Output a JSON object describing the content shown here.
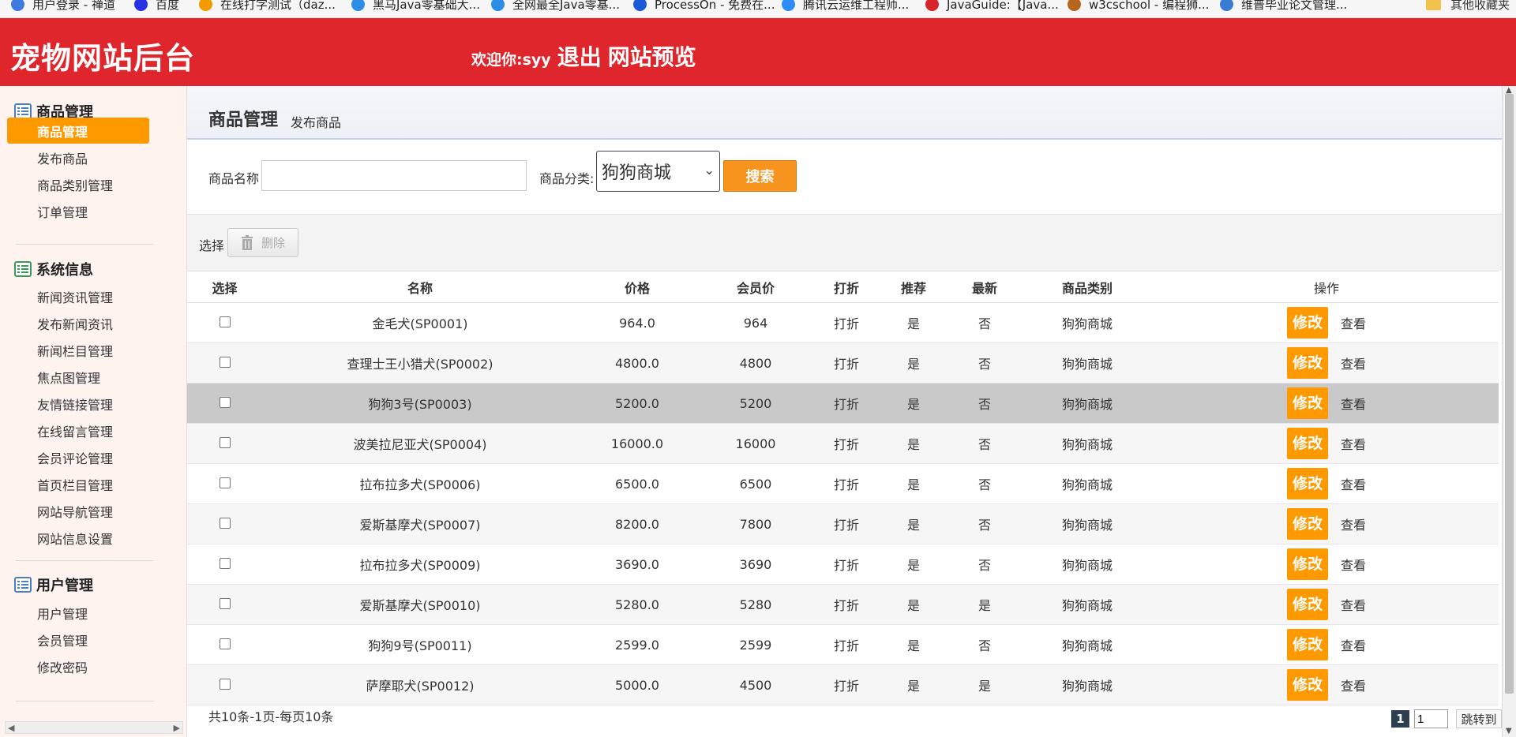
{
  "bookmarks": [
    {
      "label": "用户登录 - 禅道",
      "color": "#3d7be0"
    },
    {
      "label": "百度",
      "color": "#2932e1"
    },
    {
      "label": "在线打字测试（daz...",
      "color": "#f29b00"
    },
    {
      "label": "黑马Java零基础大...",
      "color": "#2b8de6"
    },
    {
      "label": "全网最全Java零基...",
      "color": "#2b8de6"
    },
    {
      "label": "ProcessOn - 免费在...",
      "color": "#1a5ad8"
    },
    {
      "label": "腾讯云运维工程师...",
      "color": "#2f8bf5"
    },
    {
      "label": "JavaGuide:【Java...",
      "color": "#d8252b"
    },
    {
      "label": "w3cschool - 编程狮...",
      "color": "#b5651d"
    },
    {
      "label": "维普毕业论文管理...",
      "color": "#3a7bd5"
    }
  ],
  "bookmarks_folder": "其他收藏夹",
  "header": {
    "title": "宠物网站后台",
    "welcome": "欢迎你:syy",
    "logout": "退出",
    "preview": "网站预览"
  },
  "sidebar": {
    "groups": [
      {
        "title": "商品管理",
        "items": [
          "商品管理",
          "发布商品",
          "商品类别管理",
          "订单管理"
        ],
        "active": 0
      },
      {
        "title": "系统信息",
        "items": [
          "新闻资讯管理",
          "发布新闻资讯",
          "新闻栏目管理",
          "焦点图管理",
          "友情链接管理",
          "在线留言管理",
          "会员评论管理",
          "首页栏目管理",
          "网站导航管理",
          "网站信息设置"
        ]
      },
      {
        "title": "用户管理",
        "items": [
          "用户管理",
          "会员管理",
          "修改密码"
        ]
      }
    ]
  },
  "main": {
    "title": "商品管理",
    "subtitle": "发布商品",
    "search": {
      "name_label": "商品名称",
      "name_value": "",
      "category_label": "商品分类:",
      "category_value": "狗狗商城",
      "button": "搜索"
    },
    "toolbar": {
      "select_label": "选择",
      "delete_label": "删除"
    },
    "table": {
      "headers": [
        "选择",
        "名称",
        "价格",
        "会员价",
        "打折",
        "推荐",
        "最新",
        "商品类别",
        "操作"
      ],
      "edit_label": "修改",
      "view_label": "查看",
      "rows": [
        {
          "name": "金毛犬(SP0001)",
          "price": "964.0",
          "member_price": "964",
          "discount": "打折",
          "recommend": "是",
          "latest": "否",
          "category": "狗狗商城"
        },
        {
          "name": "查理士王小猎犬(SP0002)",
          "price": "4800.0",
          "member_price": "4800",
          "discount": "打折",
          "recommend": "是",
          "latest": "否",
          "category": "狗狗商城"
        },
        {
          "name": "狗狗3号(SP0003)",
          "price": "5200.0",
          "member_price": "5200",
          "discount": "打折",
          "recommend": "是",
          "latest": "否",
          "category": "狗狗商城"
        },
        {
          "name": "波美拉尼亚犬(SP0004)",
          "price": "16000.0",
          "member_price": "16000",
          "discount": "打折",
          "recommend": "是",
          "latest": "否",
          "category": "狗狗商城"
        },
        {
          "name": "拉布拉多犬(SP0006)",
          "price": "6500.0",
          "member_price": "6500",
          "discount": "打折",
          "recommend": "是",
          "latest": "否",
          "category": "狗狗商城"
        },
        {
          "name": "爱斯基摩犬(SP0007)",
          "price": "8200.0",
          "member_price": "7800",
          "discount": "打折",
          "recommend": "是",
          "latest": "否",
          "category": "狗狗商城"
        },
        {
          "name": "拉布拉多犬(SP0009)",
          "price": "3690.0",
          "member_price": "3690",
          "discount": "打折",
          "recommend": "是",
          "latest": "否",
          "category": "狗狗商城"
        },
        {
          "name": "爱斯基摩犬(SP0010)",
          "price": "5280.0",
          "member_price": "5280",
          "discount": "打折",
          "recommend": "是",
          "latest": "是",
          "category": "狗狗商城"
        },
        {
          "name": "狗狗9号(SP0011)",
          "price": "2599.0",
          "member_price": "2599",
          "discount": "打折",
          "recommend": "是",
          "latest": "否",
          "category": "狗狗商城"
        },
        {
          "name": "萨摩耶犬(SP0012)",
          "price": "5000.0",
          "member_price": "4500",
          "discount": "打折",
          "recommend": "是",
          "latest": "是",
          "category": "狗狗商城"
        }
      ]
    },
    "footer": {
      "summary": "共10条-1页-每页10条",
      "current_page": "1",
      "page_input": "1",
      "jump_label": "跳转到"
    }
  }
}
